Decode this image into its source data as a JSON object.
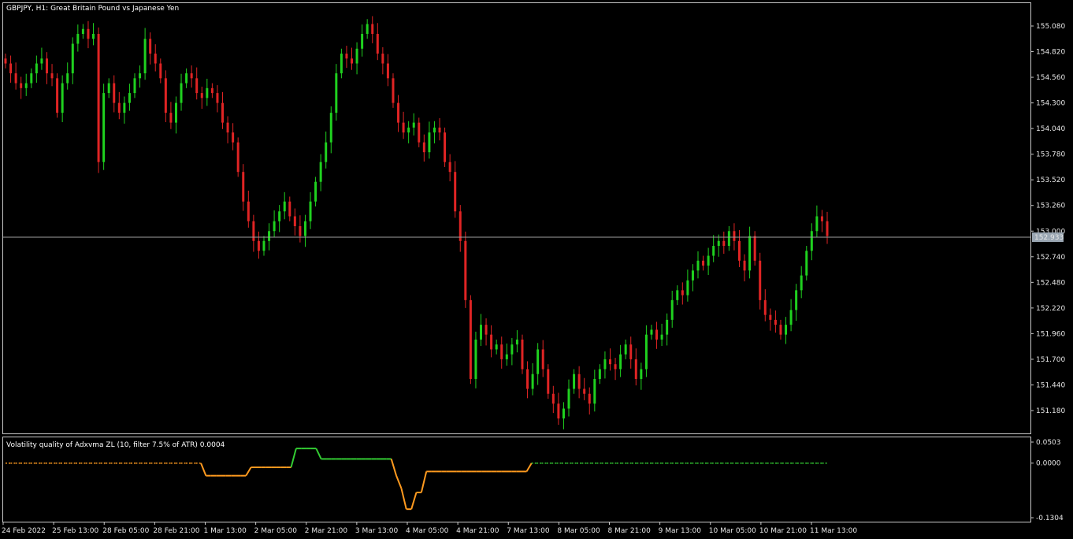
{
  "main_panel": {
    "title": "GBPJPY, H1:  Great Britain Pound vs Japanese Yen",
    "current_price": "152.933"
  },
  "indicator_panel": {
    "title": "Volatility quality of Adxvma ZL (10, filter 7.5% of ATR) 0.0004"
  },
  "colors": {
    "background": "#000000",
    "bull": "#1fd11f",
    "bear": "#e02424",
    "axis": "#c8c8c8",
    "price_line": "#a0a0a0",
    "price_tag": "#9aa6b2",
    "ind_up": "#33cc33",
    "ind_down": "#ff9a1f"
  },
  "chart_data": [
    {
      "type": "candlestick",
      "symbol": "GBPJPY",
      "timeframe": "H1",
      "ylim": [
        151.0,
        155.17
      ],
      "y_ticks": [
        "155.080",
        "154.820",
        "154.560",
        "154.300",
        "154.040",
        "153.780",
        "153.520",
        "153.260",
        "153.000",
        "152.740",
        "152.480",
        "152.220",
        "151.960",
        "151.700",
        "151.440",
        "151.180"
      ],
      "current_price": 152.933,
      "closes": [
        154.7,
        154.6,
        154.5,
        154.45,
        154.5,
        154.6,
        154.7,
        154.75,
        154.6,
        154.55,
        154.2,
        154.5,
        154.6,
        154.9,
        155.0,
        155.05,
        154.95,
        155.0,
        153.7,
        154.4,
        154.5,
        154.3,
        154.2,
        154.3,
        154.4,
        154.55,
        154.6,
        154.95,
        154.8,
        154.7,
        154.55,
        154.2,
        154.1,
        154.3,
        154.5,
        154.6,
        154.55,
        154.4,
        154.35,
        154.45,
        154.4,
        154.3,
        154.1,
        154.0,
        153.9,
        153.6,
        153.3,
        153.1,
        152.9,
        152.8,
        152.9,
        153.0,
        153.1,
        153.2,
        153.3,
        153.15,
        153.05,
        152.95,
        153.1,
        153.3,
        153.5,
        153.7,
        153.9,
        154.2,
        154.6,
        154.8,
        154.75,
        154.7,
        154.85,
        155.0,
        155.1,
        155.0,
        154.8,
        154.7,
        154.55,
        154.3,
        154.1,
        154.0,
        154.05,
        154.1,
        153.9,
        153.8,
        154.0,
        154.05,
        154.0,
        153.7,
        153.6,
        153.2,
        152.9,
        152.3,
        151.5,
        151.9,
        152.05,
        151.95,
        151.8,
        151.85,
        151.7,
        151.75,
        151.85,
        151.9,
        151.6,
        151.4,
        151.55,
        151.8,
        151.6,
        151.35,
        151.25,
        151.1,
        151.2,
        151.4,
        151.55,
        151.4,
        151.35,
        151.25,
        151.5,
        151.6,
        151.7,
        151.65,
        151.6,
        151.75,
        151.85,
        151.7,
        151.5,
        151.6,
        151.95,
        152.0,
        151.9,
        151.95,
        152.1,
        152.3,
        152.4,
        152.35,
        152.5,
        152.6,
        152.7,
        152.65,
        152.75,
        152.85,
        152.9,
        152.85,
        153.0,
        152.9,
        152.7,
        152.6,
        152.95,
        152.7,
        152.3,
        152.15,
        152.1,
        152.05,
        151.95,
        152.05,
        152.2,
        152.4,
        152.55,
        152.8,
        153.0,
        153.15,
        153.1,
        152.95
      ],
      "indicator": {
        "title": "Volatility quality of Adxvma ZL (10, filter 7.5% of ATR) 0.0004",
        "ylim": [
          -0.1304,
          0.0503
        ],
        "y_ticks": [
          "0.0503",
          "0.0000",
          "-0.1304"
        ],
        "values": [
          0,
          0,
          0,
          0,
          0,
          0,
          0,
          0,
          0,
          0,
          0,
          0,
          0,
          0,
          0,
          0,
          0,
          0,
          0,
          0,
          0,
          0,
          0,
          0,
          0,
          0,
          0,
          0,
          0,
          0,
          0,
          0,
          0,
          0,
          0,
          0,
          0,
          0,
          0,
          0,
          -0.03,
          -0.03,
          -0.03,
          -0.03,
          -0.03,
          -0.03,
          -0.03,
          -0.03,
          -0.03,
          -0.01,
          -0.01,
          -0.01,
          -0.01,
          -0.01,
          -0.01,
          -0.01,
          -0.01,
          -0.01,
          0.035,
          0.035,
          0.035,
          0.035,
          0.035,
          0.01,
          0.01,
          0.01,
          0.01,
          0.01,
          0.01,
          0.01,
          0.01,
          0.01,
          0.01,
          0.01,
          0.01,
          0.01,
          0.01,
          0.01,
          -0.03,
          -0.06,
          -0.11,
          -0.11,
          -0.07,
          -0.07,
          -0.02,
          -0.02,
          -0.02,
          -0.02,
          -0.02,
          -0.02,
          -0.02,
          -0.02,
          -0.02,
          -0.02,
          -0.02,
          -0.02,
          -0.02,
          -0.02,
          -0.02,
          -0.02,
          -0.02,
          -0.02,
          -0.02,
          -0.02,
          -0.02,
          0,
          0,
          0,
          0,
          0,
          0,
          0,
          0,
          0,
          0,
          0,
          0,
          0,
          0,
          0,
          0,
          0,
          0,
          0,
          0,
          0,
          0,
          0,
          0,
          0,
          0,
          0,
          0,
          0,
          0,
          0,
          0,
          0,
          0,
          0,
          0,
          0,
          0,
          0,
          0,
          0,
          0,
          0,
          0,
          0,
          0,
          0,
          0,
          0,
          0,
          0,
          0,
          0,
          0,
          0,
          0,
          0,
          0,
          0,
          0
        ]
      },
      "x_ticks": [
        "24 Feb 2022",
        "25 Feb 13:00",
        "28 Feb 05:00",
        "28 Feb 21:00",
        "1 Mar 13:00",
        "2 Mar 05:00",
        "2 Mar 21:00",
        "3 Mar 13:00",
        "4 Mar 05:00",
        "4 Mar 21:00",
        "7 Mar 13:00",
        "8 Mar 05:00",
        "8 Mar 21:00",
        "9 Mar 13:00",
        "10 Mar 05:00",
        "10 Mar 21:00",
        "11 Mar 13:00"
      ]
    }
  ]
}
